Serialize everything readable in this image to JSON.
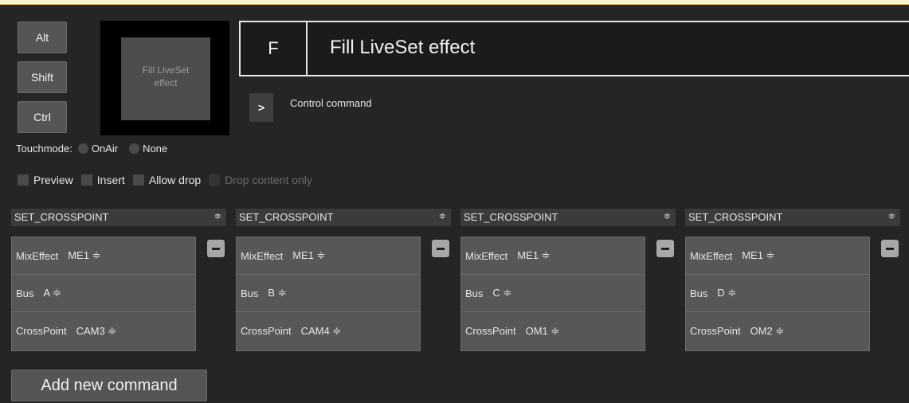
{
  "modifiers": {
    "alt": "Alt",
    "shift": "Shift",
    "ctrl": "Ctrl"
  },
  "preview": {
    "line1": "Fill LiveSet",
    "line2": "effect"
  },
  "key": {
    "letter": "F",
    "title": "Fill LiveSet effect"
  },
  "control": {
    "arrow": ">",
    "label": "Control command"
  },
  "touchmode": {
    "label": "Touchmode:",
    "options": [
      "OnAir",
      "None"
    ]
  },
  "checkboxes": [
    "Preview",
    "Insert",
    "Allow drop",
    "Drop content only"
  ],
  "commands": [
    {
      "type": "SET_CROSSPOINT",
      "mix_label": "MixEffect",
      "mix_value": "ME1 ≑",
      "bus_label": "Bus",
      "bus_value": "A ≑",
      "xp_label": "CrossPoint",
      "xp_value": "CAM3 ≑"
    },
    {
      "type": "SET_CROSSPOINT",
      "mix_label": "MixEffect",
      "mix_value": "ME1 ≑",
      "bus_label": "Bus",
      "bus_value": "B ≑",
      "xp_label": "CrossPoint",
      "xp_value": "CAM4 ≑"
    },
    {
      "type": "SET_CROSSPOINT",
      "mix_label": "MixEffect",
      "mix_value": "ME1 ≑",
      "bus_label": "Bus",
      "bus_value": "C ≑",
      "xp_label": "CrossPoint",
      "xp_value": "OM1 ≑"
    },
    {
      "type": "SET_CROSSPOINT",
      "mix_label": "MixEffect",
      "mix_value": "ME1 ≑",
      "bus_label": "Bus",
      "bus_value": "D ≑",
      "xp_label": "CrossPoint",
      "xp_value": "OM2 ≑"
    }
  ],
  "select_arrow": "≑",
  "add_command": "Add new command"
}
